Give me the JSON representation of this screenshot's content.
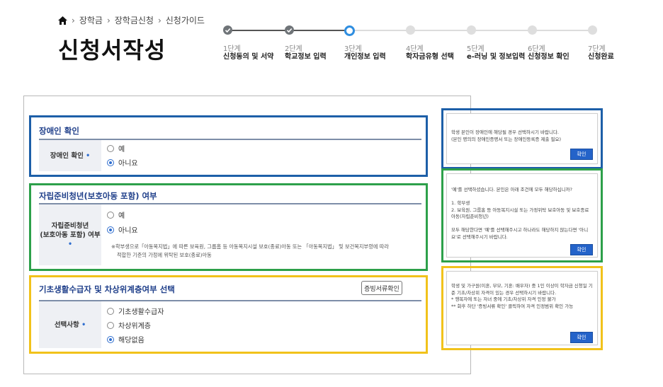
{
  "breadcrumb": {
    "items": [
      "장학금",
      "장학금신청",
      "신청가이드"
    ]
  },
  "page": {
    "title": "신청서작성"
  },
  "stepper": {
    "steps": [
      {
        "num": "1단계",
        "label": "신청동의 및 서약",
        "state": "done"
      },
      {
        "num": "2단계",
        "label": "학교정보 입력",
        "state": "done"
      },
      {
        "num": "3단계",
        "label": "개인정보 입력",
        "state": "current"
      },
      {
        "num": "4단계",
        "label": "학자금유형 선택",
        "state": "todo"
      },
      {
        "num": "5단계",
        "label": "e-러닝 및 정보입력",
        "state": "todo"
      },
      {
        "num": "6단계",
        "label": "신청정보 확인",
        "state": "todo"
      },
      {
        "num": "7단계",
        "label": "신청완료",
        "state": "todo"
      }
    ]
  },
  "sections": {
    "disability": {
      "title": "장애인 확인",
      "label": "장애인 확인",
      "required": "•",
      "options": [
        "예",
        "아니요"
      ],
      "selected": "아니요"
    },
    "independence": {
      "title": "자립준비청년(보호아동 포함) 여부",
      "label_line1": "자립준비청년",
      "label_line2": "(보호아동 포함) 여부",
      "required": "•",
      "options": [
        "예",
        "아니요"
      ],
      "selected": "아니요",
      "note_line1": "※학부생으로「아동복지법」에 따른 보육원, 그룹홈 등 아동복지시설 보호(종료)아동 또는 「아동복지법」 및 보건복지부령에 따라",
      "note_line2": "적합한 기준의 가정에 위탁된 보호(종료)아동"
    },
    "basic_living": {
      "title": "기초생활수급자 및 차상위계층여부 선택",
      "docs_button": "증빙서류확인",
      "label": "선택사항",
      "required": "•",
      "options": [
        "기초생활수급자",
        "차상위계층",
        "해당없음"
      ],
      "selected": "해당없음"
    }
  },
  "dialogs": {
    "disability": {
      "text": "학생 본인이 장애인에 해당될 경우 선택하시기 바랍니다.\n(본인 명의의 장애인증명서 또는 장애인등록증 제출 필요)",
      "button": "확인"
    },
    "independence": {
      "text": "'예'를 선택하셨습니다. 본인은 아래 조건에 모두 해당하십니까?\n\n1. 학부생\n2. 보육원, 그룹홈 등 아동복지시설 또는 가정위탁 보호아동 및 보호종료아동(자립준비청년)\n\n모두 해당한다면 '예'를 선택해주시고 하나라도 해당하지 않는다면 '아니요'로 선택해주시기 바랍니다.",
      "button": "확인"
    },
    "basic_living": {
      "text": "학생 및 가구원(이혼, 부모, 기혼: 배우자) 중 1인 이상이 학자금 신청일 기준 기초/차상위 자격이 있는 경우 선택하시기 바랍니다.\n* 행복자에 또는 자녀 중에 기초/차상위 자격 인정 불가\n** 화후 하단 '증빙서류 확인' 클릭하여 자격 인정범위 확인 가능",
      "button": "확인"
    }
  },
  "colors": {
    "blue_frame": "#1d5fa8",
    "green_frame": "#2da04a",
    "yellow_frame": "#f1c21b",
    "accent": "#2f6ecf",
    "stepper_current": "#2f8ee0",
    "confirm_button": "#2463c9"
  }
}
